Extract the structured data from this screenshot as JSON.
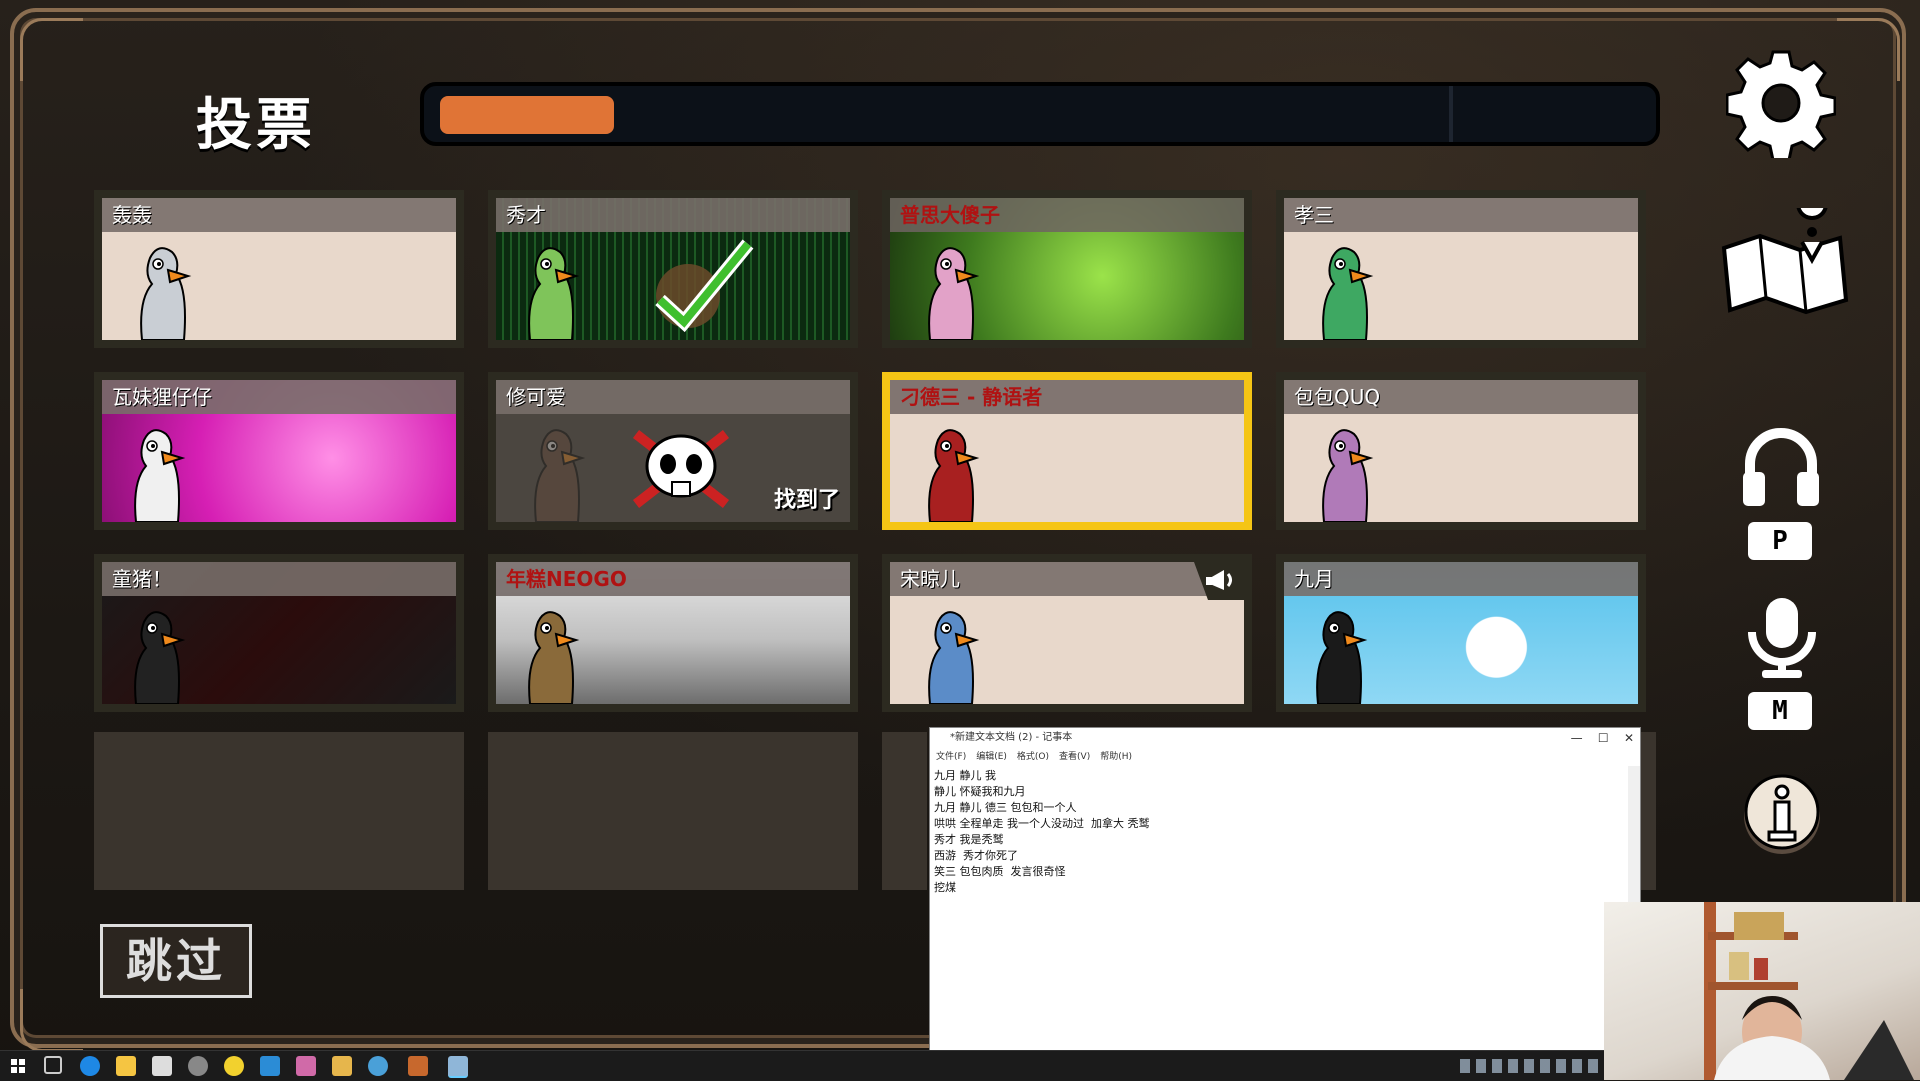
{
  "screen": {
    "title": "投票"
  },
  "timer": {
    "progress": 0.14,
    "fill_color": "#e07436"
  },
  "players": [
    {
      "name": "轰轰",
      "name_style": "white",
      "background": "plain",
      "duck_color": "#c9ced4",
      "state": "normal"
    },
    {
      "name": "秀才",
      "name_style": "white",
      "background": "matrix",
      "duck_color": "#7fc45a",
      "state": "voted"
    },
    {
      "name": "普思大傻子",
      "name_style": "red",
      "background": "green-monster",
      "duck_color": "#e2a2c8",
      "state": "normal"
    },
    {
      "name": "孝三",
      "name_style": "white",
      "background": "plain",
      "duck_color": "#3ea862",
      "state": "normal"
    },
    {
      "name": "瓦妹狸仔仔",
      "name_style": "white",
      "background": "pink-hearts",
      "duck_color": "#f0f0f0",
      "state": "normal"
    },
    {
      "name": "修可爱",
      "name_style": "white",
      "background": "dead",
      "duck_color": "#6b4a3a",
      "state": "dead",
      "status_text": "找到了"
    },
    {
      "name": "刁德三 - 静语者",
      "name_style": "red",
      "background": "plain",
      "duck_color": "#a82020",
      "state": "selected"
    },
    {
      "name": "包包QUQ",
      "name_style": "white",
      "background": "plain",
      "duck_color": "#b07ab8",
      "state": "normal"
    },
    {
      "name": "童猪！",
      "name_style": "white",
      "background": "dark-red",
      "duck_color": "#222222",
      "state": "normal"
    },
    {
      "name": "年糕NEOGO",
      "name_style": "red",
      "background": "gray-city",
      "duck_color": "#8a6a3a",
      "state": "normal"
    },
    {
      "name": "宋晾儿",
      "name_style": "white",
      "background": "plain",
      "duck_color": "#5b8cc8",
      "state": "speaking"
    },
    {
      "name": "九月",
      "name_style": "white",
      "background": "sky",
      "duck_color": "#1a1a1a",
      "state": "normal"
    }
  ],
  "skip_button": {
    "label": "跳过"
  },
  "side_keys": {
    "push_to_talk": "P",
    "mute": "M"
  },
  "icons": [
    "gear-icon",
    "map-icon",
    "headphones-icon",
    "microphone-icon",
    "info-icon",
    "megaphone-icon",
    "skull-icon",
    "checkmark-icon"
  ],
  "notepad": {
    "title": "*新建文本文档 (2) - 记事本",
    "menu": [
      "文件(F)",
      "编辑(E)",
      "格式(O)",
      "查看(V)",
      "帮助(H)"
    ],
    "lines": [
      "九月 静儿 我",
      "静儿 怀疑我和九月",
      "九月 静儿 德三 包包和一个人",
      "哄哄 全程单走 我一个人没动过  加拿大 秃鹫",
      "秀才 我是秃鹫",
      "西游  秀才你死了",
      "笑三 包包肉质  发言很奇怪",
      "挖煤"
    ]
  }
}
